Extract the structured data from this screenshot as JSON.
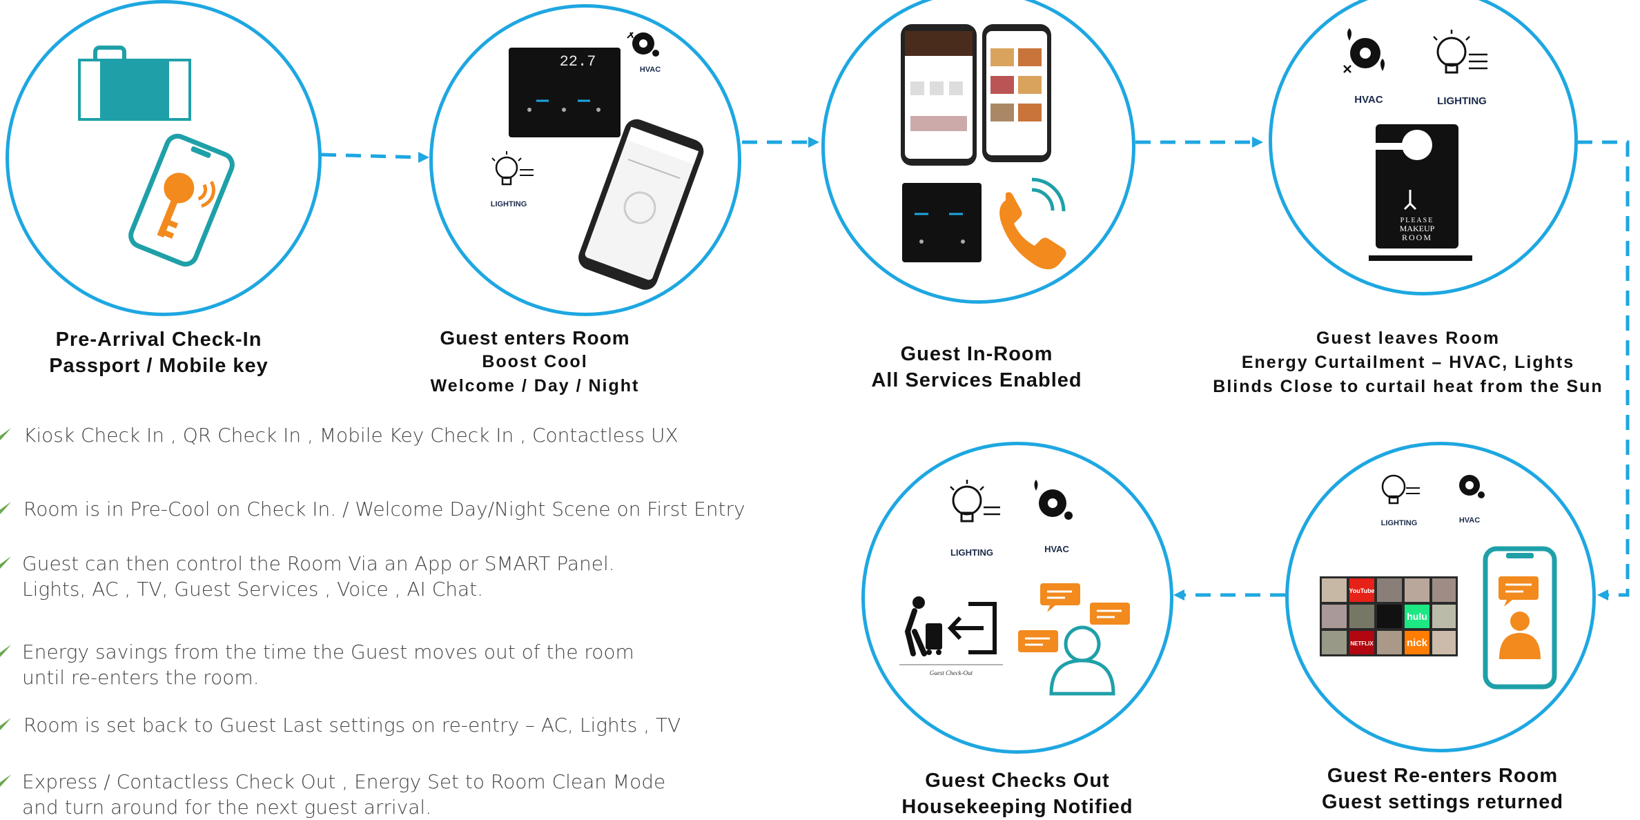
{
  "colors": {
    "accent": "#1ea7e1",
    "teal": "#1fa0a8",
    "orange": "#f28a1e",
    "navy": "#1b2a4a",
    "check": "#6aa84f"
  },
  "stages": [
    {
      "title_lines": [
        "Pre-Arrival Check-In",
        "Passport / Mobile key"
      ],
      "icons": [
        "suitcase-icon",
        "mobile-key-icon"
      ]
    },
    {
      "title_lines": [
        "Guest enters Room",
        "Boost Cool",
        "Welcome / Day / Night"
      ],
      "icons": [
        "smart-panel-icon",
        "hvac-icon",
        "lighting-icon",
        "phone-app-icon"
      ],
      "labels": {
        "hvac": "HVAC",
        "lighting": "LIGHTING",
        "display": "22.7"
      }
    },
    {
      "title_lines": [
        "Guest In-Room",
        "All Services Enabled"
      ],
      "icons": [
        "phone-app-icon",
        "smart-panel-icon",
        "phone-call-icon"
      ]
    },
    {
      "title_lines": [
        "Guest leaves Room",
        "Energy Curtailment – HVAC, Lights",
        "Blinds Close to curtail heat from the Sun"
      ],
      "icons": [
        "hvac-icon",
        "lighting-icon",
        "door-hanger-icon"
      ],
      "labels": {
        "hvac": "HVAC",
        "lighting": "LIGHTING",
        "hanger_lines": [
          "PLEASE",
          "MAKEUP",
          "ROOM"
        ]
      }
    },
    {
      "title_lines": [
        "Guest Re-enters Room",
        "Guest settings returned"
      ],
      "icons": [
        "lighting-icon",
        "hvac-icon",
        "tv-apps-icon",
        "phone-chat-icon"
      ],
      "labels": {
        "lighting": "LIGHTING",
        "hvac": "HVAC",
        "apps": [
          "YouTube",
          "hulu",
          "NETFLIX",
          "nick"
        ]
      }
    },
    {
      "title_lines": [
        "Guest Checks Out",
        "Housekeeping Notified"
      ],
      "icons": [
        "lighting-icon",
        "hvac-icon",
        "checkout-icon",
        "chat-person-icon"
      ],
      "labels": {
        "lighting": "LIGHTING",
        "hvac": "HVAC",
        "checkout": "Guest Check-Out"
      }
    }
  ],
  "bullets": [
    "Kiosk Check In , QR Check In , Mobile Key Check In , Contactless  UX",
    "Room is in Pre-Cool on Check In. / Welcome Day/Night Scene on First Entry",
    "Guest can then control the Room Via an  App or SMART Panel.\nLights, AC , TV, Guest Services , Voice , AI Chat.",
    "Energy savings from the time the Guest moves out of the room\nuntil re-enters the room.",
    "Room is set back to Guest Last settings on re-entry – AC, Lights , TV",
    "Express / Contactless Check Out , Energy Set to Room Clean Mode\nand turn around for the next guest arrival."
  ]
}
